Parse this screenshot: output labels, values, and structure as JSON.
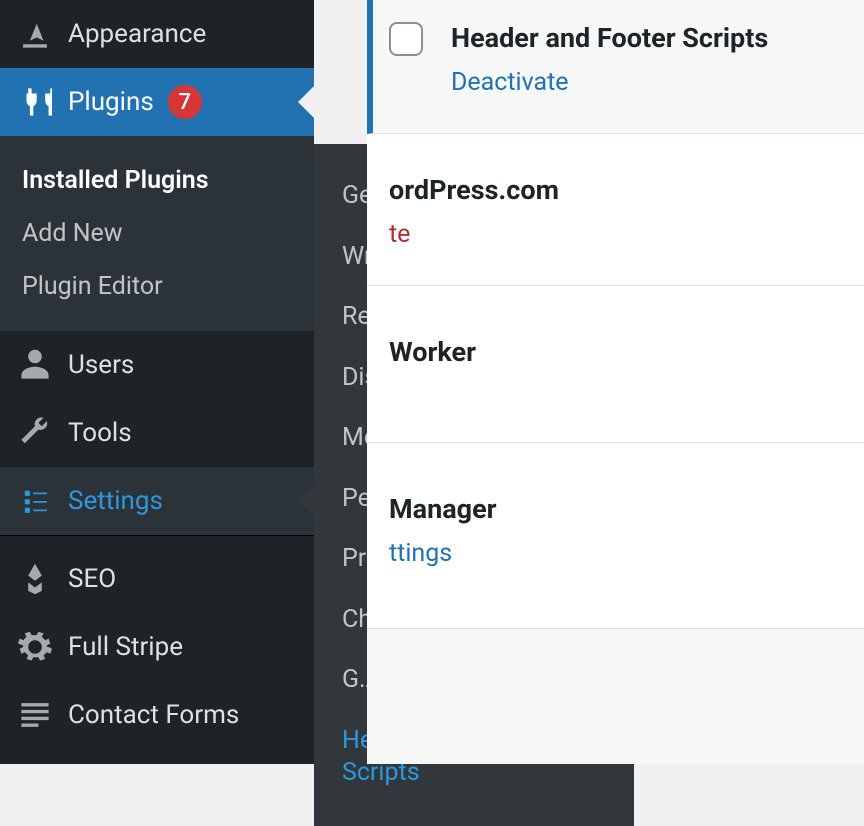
{
  "sidebar": {
    "appearance": "Appearance",
    "plugins": "Plugins",
    "plugins_badge": "7",
    "plugins_sub": [
      {
        "label": "Installed Plugins",
        "active": true
      },
      {
        "label": "Add New"
      },
      {
        "label": "Plugin Editor"
      }
    ],
    "users": "Users",
    "tools": "Tools",
    "settings": "Settings",
    "seo": "SEO",
    "fullstripe": "Full Stripe",
    "contactforms": "Contact Forms"
  },
  "settings_flyout": [
    {
      "label": "General"
    },
    {
      "label": "Writing"
    },
    {
      "label": "Reading"
    },
    {
      "label": "Discussion"
    },
    {
      "label": "Media"
    },
    {
      "label": "Permalinks"
    },
    {
      "label": "Privacy"
    },
    {
      "label": "Child-Theme Gen"
    },
    {
      "label": "G.A.S.P."
    },
    {
      "label": "Header and Footer Scripts",
      "highlight": true
    }
  ],
  "plugins_list": [
    {
      "title": "Header and Footer Scripts",
      "actions": [
        {
          "text": "Deactivate",
          "color": "blue"
        }
      ],
      "active": true,
      "checkbox": true
    },
    {
      "title": "ordPress.com",
      "actions": [
        {
          "text": "te",
          "color": "red"
        }
      ],
      "checkbox": false
    },
    {
      "title": "Worker",
      "actions": [],
      "checkbox": false
    },
    {
      "title": "Manager",
      "actions": [
        {
          "text": "ttings",
          "color": "blue"
        }
      ],
      "checkbox": false
    }
  ]
}
